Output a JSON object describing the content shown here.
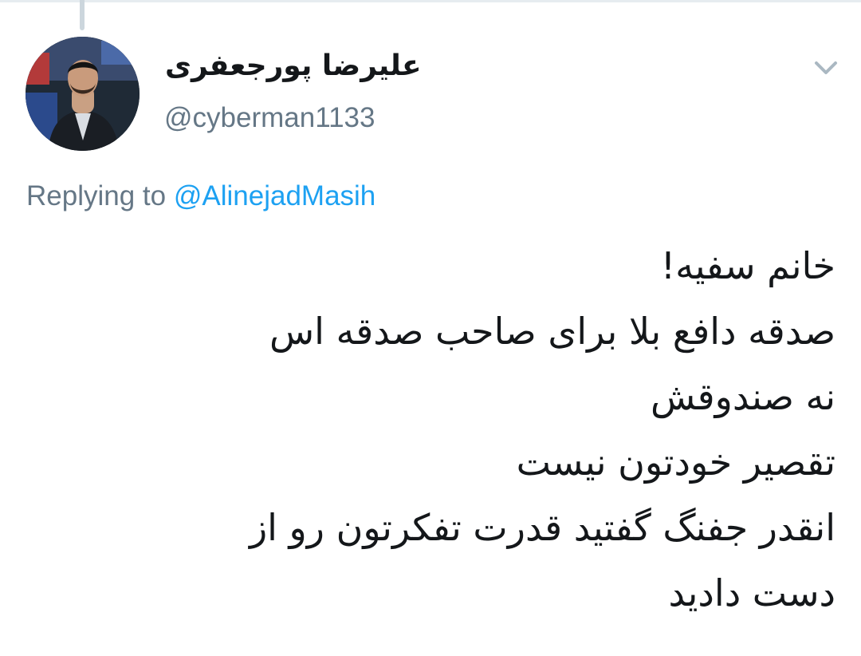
{
  "tweet": {
    "author": {
      "display_name": "علیرضا پورجعفری",
      "handle": "@cyberman1133",
      "avatar_icon": "user-photo-avatar"
    },
    "menu_icon": "chevron-down-icon",
    "reply_context": {
      "prefix": "Replying to",
      "mention": "@AlinejadMasih"
    },
    "text_lines": [
      "خانم سفیه!",
      "صدقه دافع بلا برای صاحب صدقه اس",
      "نه صندوقش",
      "تقصیر خودتون نیست",
      "انقدر جفنگ گفتید قدرت تفکرتون رو از",
      "دست دادید"
    ]
  },
  "colors": {
    "name": "#14171a",
    "secondary": "#657786",
    "link": "#1da1f2",
    "thread_line": "#ccd6dd",
    "caret": "#aab8c2"
  }
}
